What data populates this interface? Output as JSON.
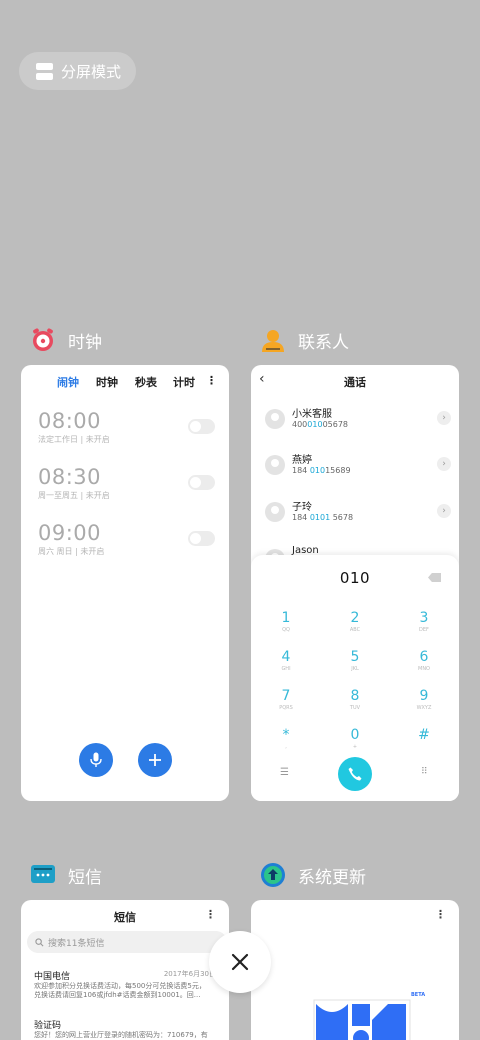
{
  "split_screen": {
    "label": "分屏模式",
    "icon": "split-screen-icon"
  },
  "clock": {
    "app_name": "时钟",
    "tabs": [
      {
        "label": "闹钟",
        "active": true
      },
      {
        "label": "时钟",
        "active": false
      },
      {
        "label": "秒表",
        "active": false
      },
      {
        "label": "计时",
        "active": false
      }
    ],
    "more": "⋮",
    "alarms": [
      {
        "time": "08:00",
        "desc": "法定工作日 | 未开启"
      },
      {
        "time": "08:30",
        "desc": "周一至周五 | 未开启"
      },
      {
        "time": "09:00",
        "desc": "周六 周日 | 未开启"
      }
    ],
    "accent": "#2c7be5"
  },
  "contacts": {
    "app_name": "联系人",
    "screen_title": "通话",
    "rows": [
      {
        "name": "小米客服",
        "pre": "400",
        "match": "010",
        "post": "05678"
      },
      {
        "name": "燕婷",
        "pre": "184 ",
        "match": "010",
        "post": "15689"
      },
      {
        "name": "子玲",
        "pre": "184 ",
        "match": "0101",
        "post": " 5678"
      },
      {
        "name": "Jason",
        "pre": "",
        "match": "",
        "post": ""
      }
    ],
    "dialed": "010",
    "keys": [
      {
        "d": "1",
        "l": "QQ"
      },
      {
        "d": "2",
        "l": "ABC"
      },
      {
        "d": "3",
        "l": "DEF"
      },
      {
        "d": "4",
        "l": "GHI"
      },
      {
        "d": "5",
        "l": "JKL"
      },
      {
        "d": "6",
        "l": "MNO"
      },
      {
        "d": "7",
        "l": "PQRS"
      },
      {
        "d": "8",
        "l": "TUV"
      },
      {
        "d": "9",
        "l": "WXYZ"
      },
      {
        "d": "*",
        "l": ","
      },
      {
        "d": "0",
        "l": "+"
      },
      {
        "d": "#",
        "l": ""
      }
    ],
    "accent": "#21c8e0"
  },
  "sms": {
    "app_name": "短信",
    "screen_title": "短信",
    "search_placeholder": "搜索11条短信",
    "messages": [
      {
        "from": "中国电信",
        "date": "2017年6月30日",
        "body1": "欢迎参加积分兑换话费活动，每500分可兑换话费5元，",
        "body2": "兑换话费请回复106或jfdh#话费金额到10001。回..."
      },
      {
        "from": "验证码",
        "date": "",
        "body1": "您好！您的网上营业厅登录的随机密码为：710679，有",
        "body2": ""
      }
    ]
  },
  "update": {
    "app_name": "系统更新",
    "badge": "BETA"
  }
}
